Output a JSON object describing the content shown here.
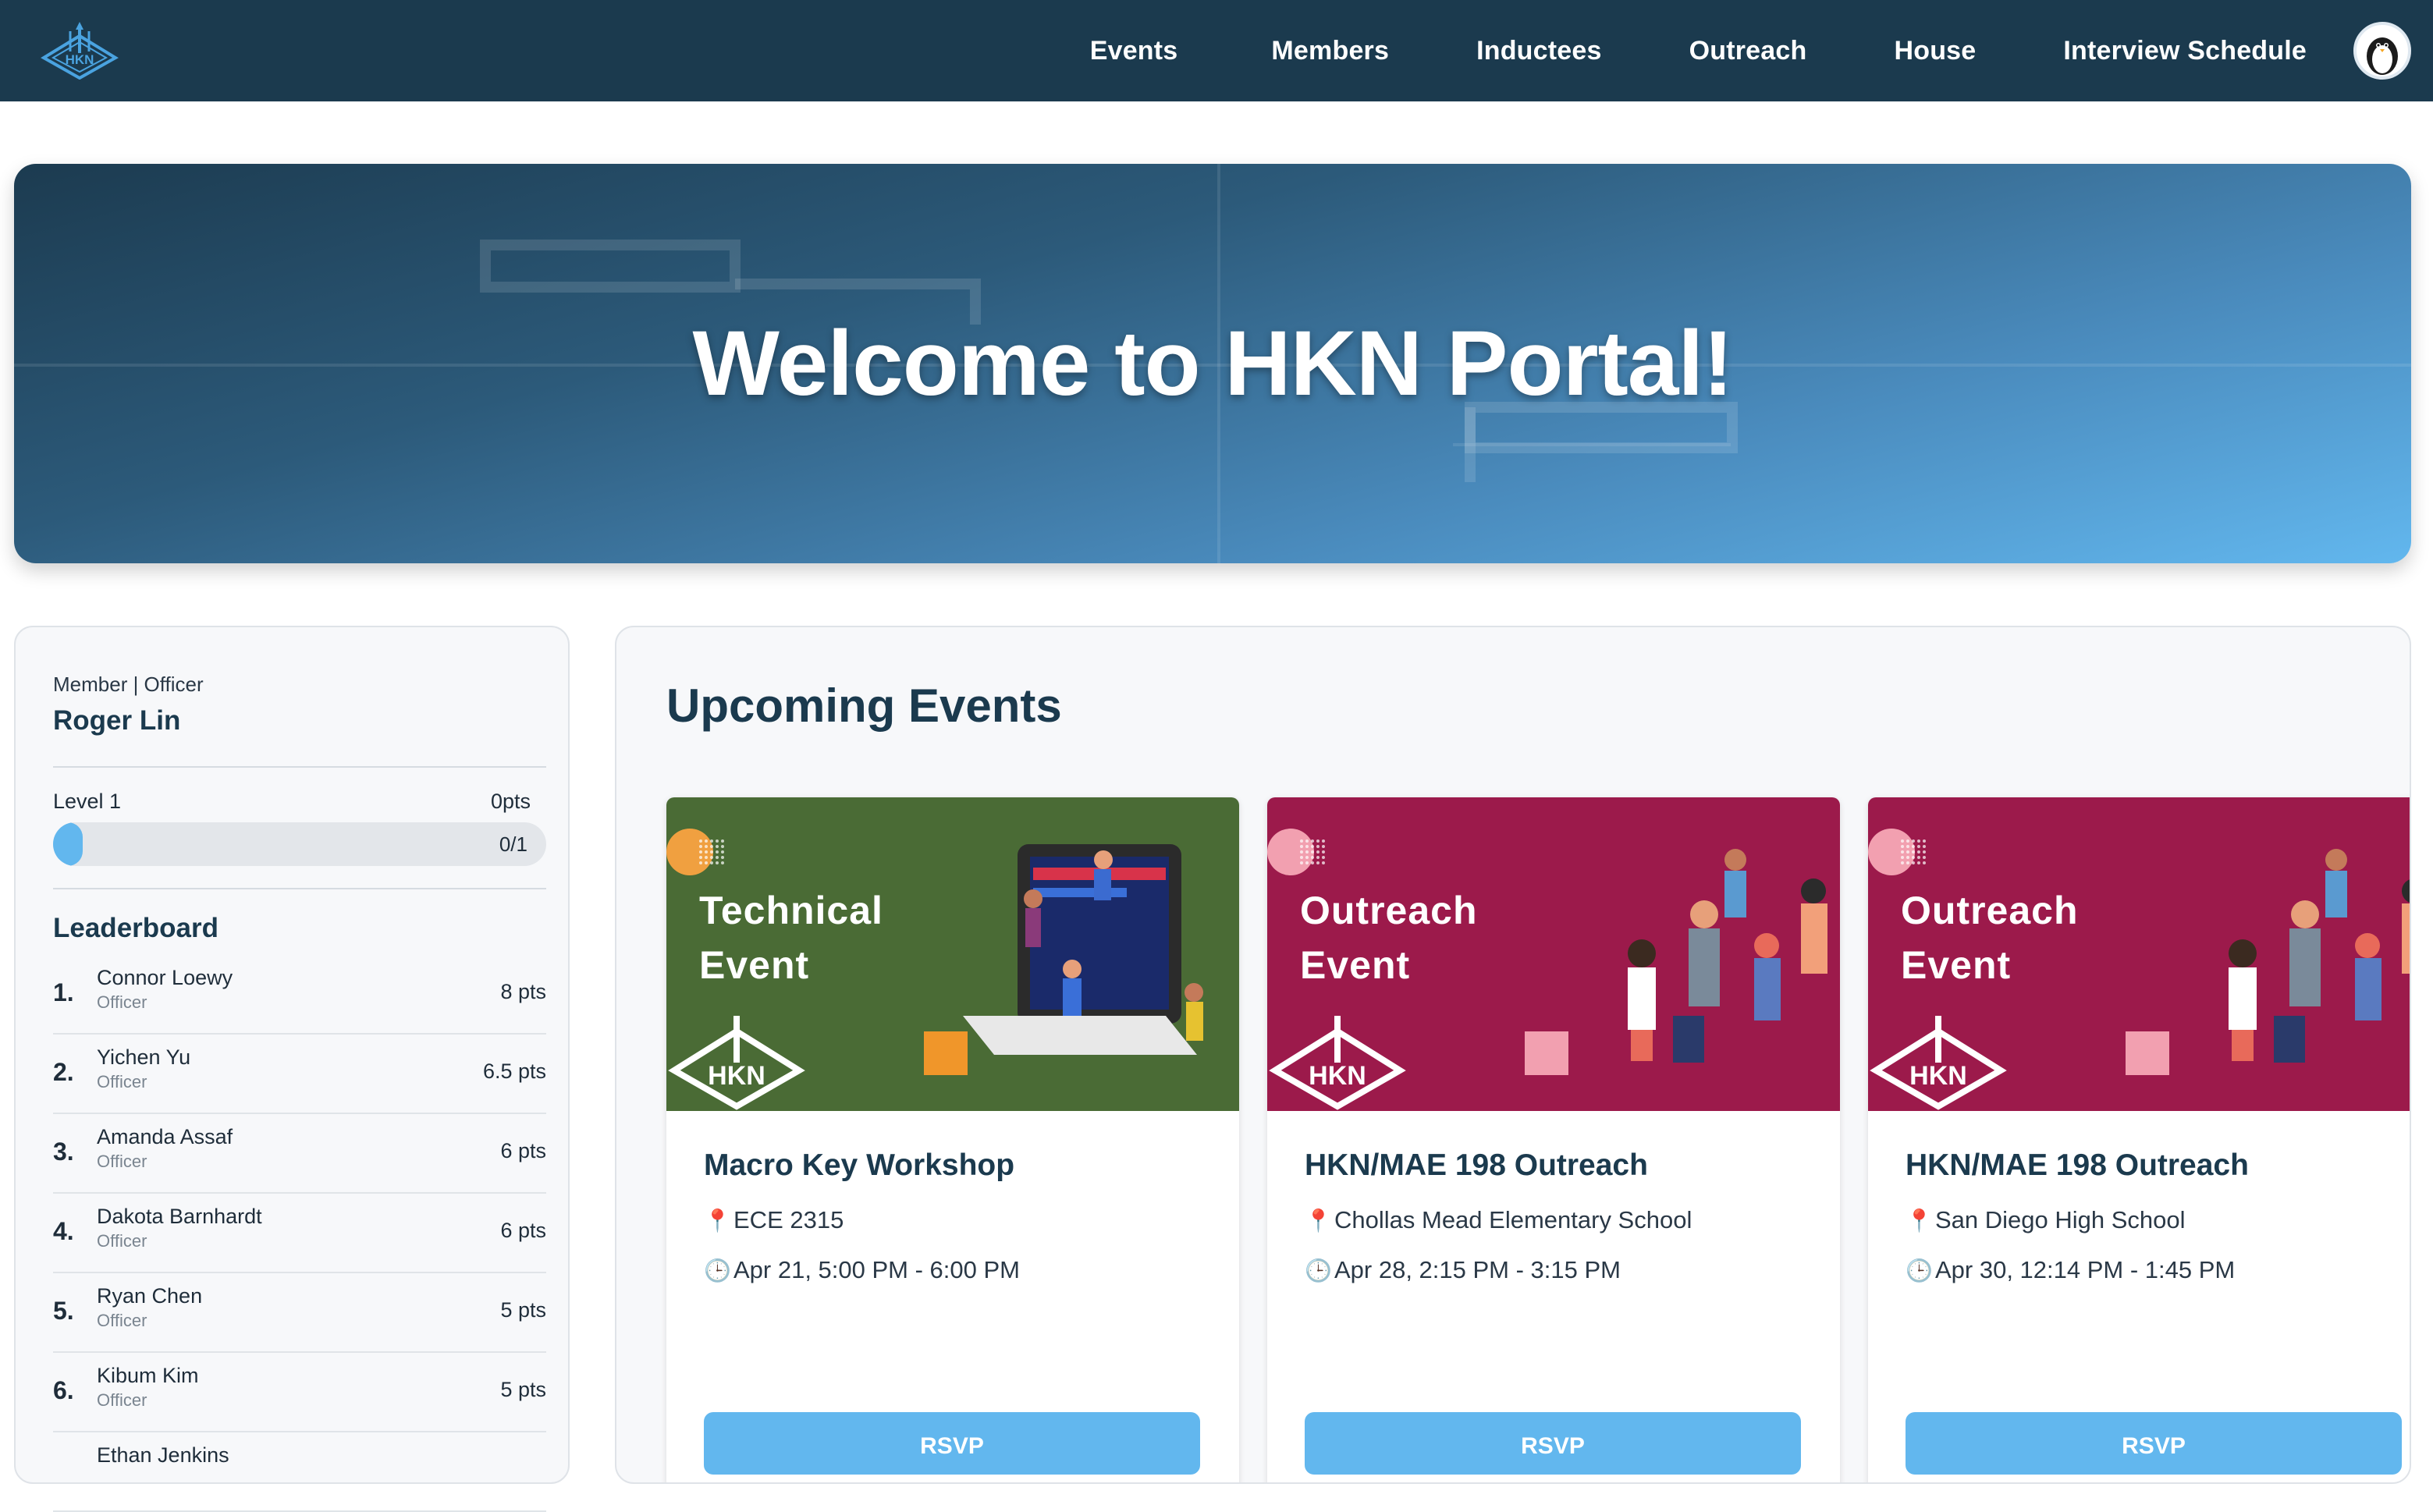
{
  "nav": {
    "logo_alt": "HKN",
    "links": [
      "Events",
      "Members",
      "Inductees",
      "Outreach",
      "House",
      "Interview Schedule"
    ]
  },
  "hero": {
    "title": "Welcome to HKN Portal!"
  },
  "profile": {
    "role": "Member | Officer",
    "name": "Roger Lin",
    "level": "Level 1",
    "points": "0pts",
    "progress_text": "0/1",
    "progress_fraction": 0.06
  },
  "leaderboard": {
    "title": "Leaderboard",
    "rows": [
      {
        "rank": "1.",
        "name": "Connor Loewy",
        "role": "Officer",
        "pts": "8 pts"
      },
      {
        "rank": "2.",
        "name": "Yichen Yu",
        "role": "Officer",
        "pts": "6.5 pts"
      },
      {
        "rank": "3.",
        "name": "Amanda Assaf",
        "role": "Officer",
        "pts": "6 pts"
      },
      {
        "rank": "4.",
        "name": "Dakota Barnhardt",
        "role": "Officer",
        "pts": "6 pts"
      },
      {
        "rank": "5.",
        "name": "Ryan Chen",
        "role": "Officer",
        "pts": "5 pts"
      },
      {
        "rank": "6.",
        "name": "Kibum Kim",
        "role": "Officer",
        "pts": "5 pts"
      },
      {
        "rank": "",
        "name": "Ethan Jenkins",
        "role": "",
        "pts": ""
      }
    ]
  },
  "events": {
    "title": "Upcoming Events",
    "items": [
      {
        "cap1": "Technical",
        "cap2": "Event",
        "name": "Macro Key Workshop",
        "location": "ECE 2315",
        "time": "Apr 21, 5:00 PM - 6:00 PM",
        "rsvp": "RSVP",
        "color": "#4a6b35"
      },
      {
        "cap1": "Outreach",
        "cap2": "Event",
        "name": "HKN/MAE 198 Outreach",
        "location": "Chollas Mead Elementary School",
        "time": "Apr 28, 2:15 PM - 3:15 PM",
        "rsvp": "RSVP",
        "color": "#9c1a4b"
      },
      {
        "cap1": "Outreach",
        "cap2": "Event",
        "name": "HKN/MAE 198 Outreach",
        "location": "San Diego High School",
        "time": "Apr 30, 12:14 PM - 1:45 PM",
        "rsvp": "RSVP",
        "color": "#9c1a4b"
      }
    ]
  }
}
